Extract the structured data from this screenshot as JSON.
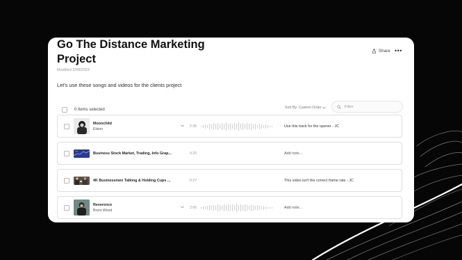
{
  "project": {
    "title": "Go The Distance Marketing Project",
    "modified": "Modified 2/08/2023",
    "description": "Let's use these songs and videos for the clients project"
  },
  "header_actions": {
    "share_label": "Share",
    "more_label": "•••"
  },
  "toolbar": {
    "selected_count": "0 Items selected",
    "sort_label": "Sort By: Custom Order",
    "filter_placeholder": "Filter"
  },
  "items": [
    {
      "title": "Moonchild",
      "artist": "Elsion",
      "duration": "2:35",
      "note": "Use this track for the opener - JC",
      "kind": "song"
    },
    {
      "title": "Business Stock Market, Trading, Info Grap...",
      "artist": "",
      "duration": "0:20",
      "note": "Add note...",
      "kind": "video"
    },
    {
      "title": "4K Businessmen Talking & Holding Cups ...",
      "artist": "",
      "duration": "0:27",
      "note": "This video isn't the correct frame rate - JC",
      "kind": "video"
    },
    {
      "title": "Reverence",
      "artist": "Brent Wood",
      "duration": "2:06",
      "note": "Add note...",
      "kind": "song"
    }
  ],
  "colors": {
    "background": "#060606",
    "card": "#ffffff",
    "accent_text": "#111111"
  }
}
